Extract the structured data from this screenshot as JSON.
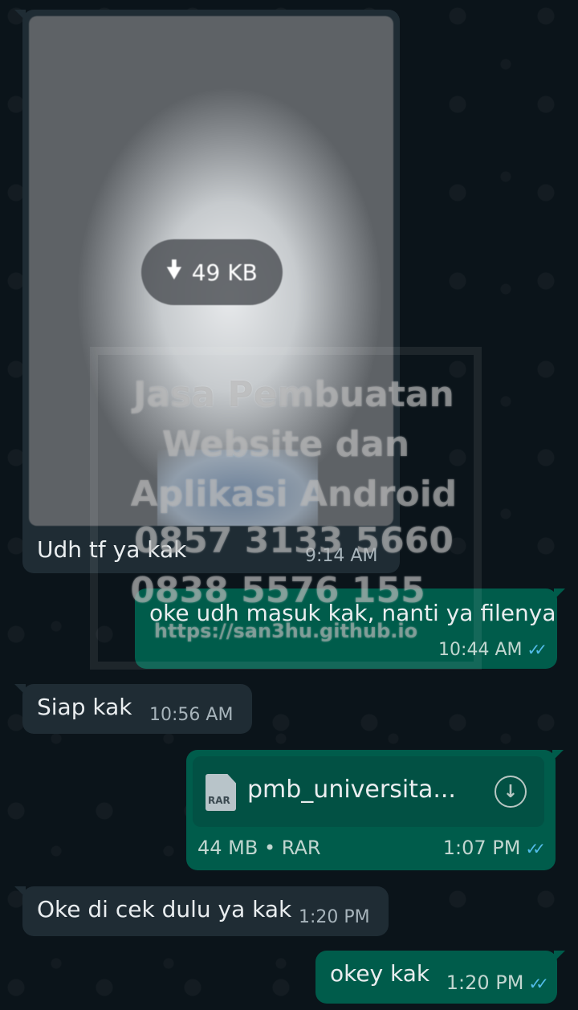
{
  "messages": {
    "image_msg": {
      "download_size": "49 KB",
      "caption": "Udh tf ya kak",
      "time": "9:14 AM"
    },
    "out1": {
      "text": "oke udh masuk kak, nanti ya filenya",
      "time": "10:44 AM",
      "status": "read"
    },
    "in1": {
      "text": "Siap kak",
      "time": "10:56 AM"
    },
    "file_msg": {
      "icon_label": "RAR",
      "filename": "pmb_universita...",
      "meta": "44 MB • RAR",
      "time": "1:07 PM",
      "status": "read"
    },
    "in2": {
      "text": "Oke di cek dulu ya kak",
      "time": "1:20 PM"
    },
    "out2": {
      "text": "okey kak",
      "time": "1:20 PM",
      "status": "read"
    }
  },
  "watermark": {
    "line1": "Jasa Pembuatan",
    "line2": "Website dan",
    "line3": "Aplikasi Android",
    "line4": "0857 3133 5660",
    "line5": "0838 5576 155",
    "line6": "https://san3hu.github.io"
  },
  "icons": {
    "read_ticks": "double-check-icon",
    "download": "download-arrow-icon",
    "file": "rar-file-icon"
  },
  "colors": {
    "background": "#0b141a",
    "incoming_bubble": "#1f2c34",
    "outgoing_bubble": "#005c4b",
    "read_tick": "#53bdeb"
  }
}
